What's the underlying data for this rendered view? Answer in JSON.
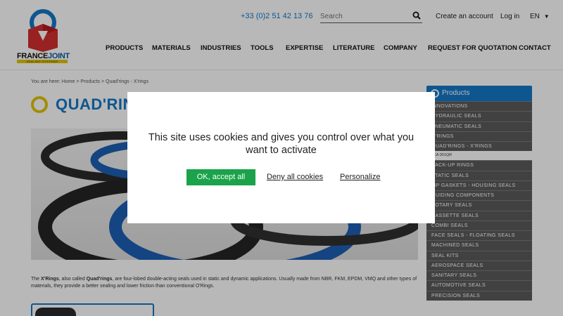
{
  "header": {
    "logo": {
      "brand_left": "FRANCE",
      "brand_right": "JOINT",
      "tagline": "SEALING SYSTEMS"
    },
    "phone": "+33 (0)2 51 42 13 76",
    "search": {
      "placeholder": "Search",
      "icon": "search-icon"
    },
    "create_account": "Create an account",
    "login": "Log in",
    "language": "EN"
  },
  "nav": [
    "PRODUCTS",
    "MATERIALS",
    "INDUSTRIES",
    "TOOLS",
    "EXPERTISE",
    "LITERATURE",
    "COMPANY",
    "REQUEST FOR QUOTATION",
    "CONTACT"
  ],
  "breadcrumb": {
    "prefix": "You are here:",
    "items": [
      "Home",
      "Products",
      "Quad'rings - X'rings"
    ],
    "separator": ">"
  },
  "page": {
    "title": "QUAD'RINGS",
    "description_b1": "X'Rings",
    "description_t1": ", also called ",
    "description_b2": "Quad'rings",
    "description_t2": ", are four-lobed double-acting seals used in static and dynamic applications. Usually made from NBR, FKM, EPDM, VMQ and other types of materials, they provide a better sealing and lower friction than conventional O'Rings."
  },
  "sidebar": {
    "title": "Products",
    "items": [
      "INNOVATIONS",
      "HYDRAULIC SEALS",
      "PNEUMATIC SEALS",
      "O'RINGS",
      "QUAD'RINGS - X'RINGS"
    ],
    "sub_item": "JCA 001QR",
    "items2": [
      "BACK-UP RINGS",
      "STATIC SEALS",
      "LIP GASKETS - HOUSING SEALS",
      "GUIDING COMPONENTS",
      "ROTARY SEALS",
      "CASSETTE SEALS",
      "COMBI SEALS",
      "FACE SEALS - FLOATING SEALS",
      "MACHINED SEALS",
      "SEAL KITS",
      "AEROSPACE SEALS",
      "SANITARY SEALS",
      "AUTOMOTIVE SEALS",
      "PRECISION SEALS"
    ]
  },
  "cookie": {
    "message": "This site uses cookies and gives you control over what you want to activate",
    "accept": "OK, accept all",
    "deny": "Deny all cookies",
    "personalize": "Personalize"
  },
  "colors": {
    "brand_blue": "#1478c8",
    "accent_yellow": "#e2c400",
    "accept_green": "#1aa34a",
    "sidebar_gray": "#5a5a5a"
  }
}
